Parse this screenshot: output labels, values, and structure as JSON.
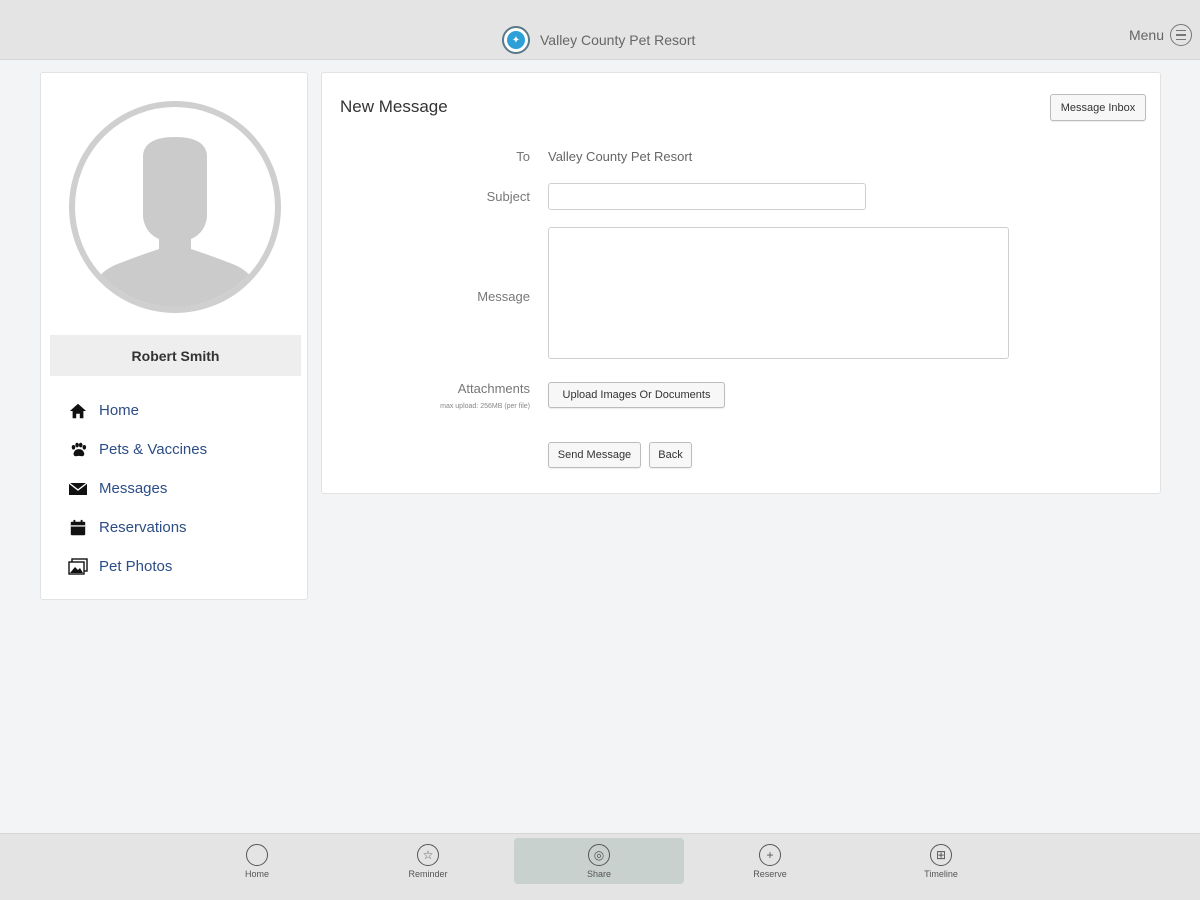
{
  "header": {
    "brand_name": "Valley County Pet Resort",
    "menu_label": "Menu"
  },
  "sidebar": {
    "user_name": "Robert Smith",
    "items": [
      {
        "label": "Home",
        "icon": "home-icon"
      },
      {
        "label": "Pets & Vaccines",
        "icon": "paw-icon"
      },
      {
        "label": "Messages",
        "icon": "envelope-icon"
      },
      {
        "label": "Reservations",
        "icon": "calendar-icon"
      },
      {
        "label": "Pet Photos",
        "icon": "photos-icon"
      }
    ]
  },
  "main": {
    "title": "New Message",
    "inbox_button": "Message Inbox",
    "to_label": "To",
    "to_value": "Valley County Pet Resort",
    "subject_label": "Subject",
    "subject_value": "",
    "message_label": "Message",
    "message_value": "",
    "attachments_label": "Attachments",
    "attachments_hint": "max upload: 256MB (per file)",
    "upload_button": "Upload Images Or Documents",
    "send_button": "Send Message",
    "back_button": "Back"
  },
  "tabs": [
    {
      "label": "Home",
      "icon": "circle-icon",
      "active": false
    },
    {
      "label": "Reminder",
      "icon": "star-icon",
      "active": false
    },
    {
      "label": "Share",
      "icon": "share-icon",
      "active": true
    },
    {
      "label": "Reserve",
      "icon": "plus-icon",
      "active": false
    },
    {
      "label": "Timeline",
      "icon": "timeline-icon",
      "active": false
    }
  ],
  "colors": {
    "accent_link": "#2c4d86",
    "active_tab": "#c8d1cd",
    "logo_blue": "#2f9fd8"
  }
}
